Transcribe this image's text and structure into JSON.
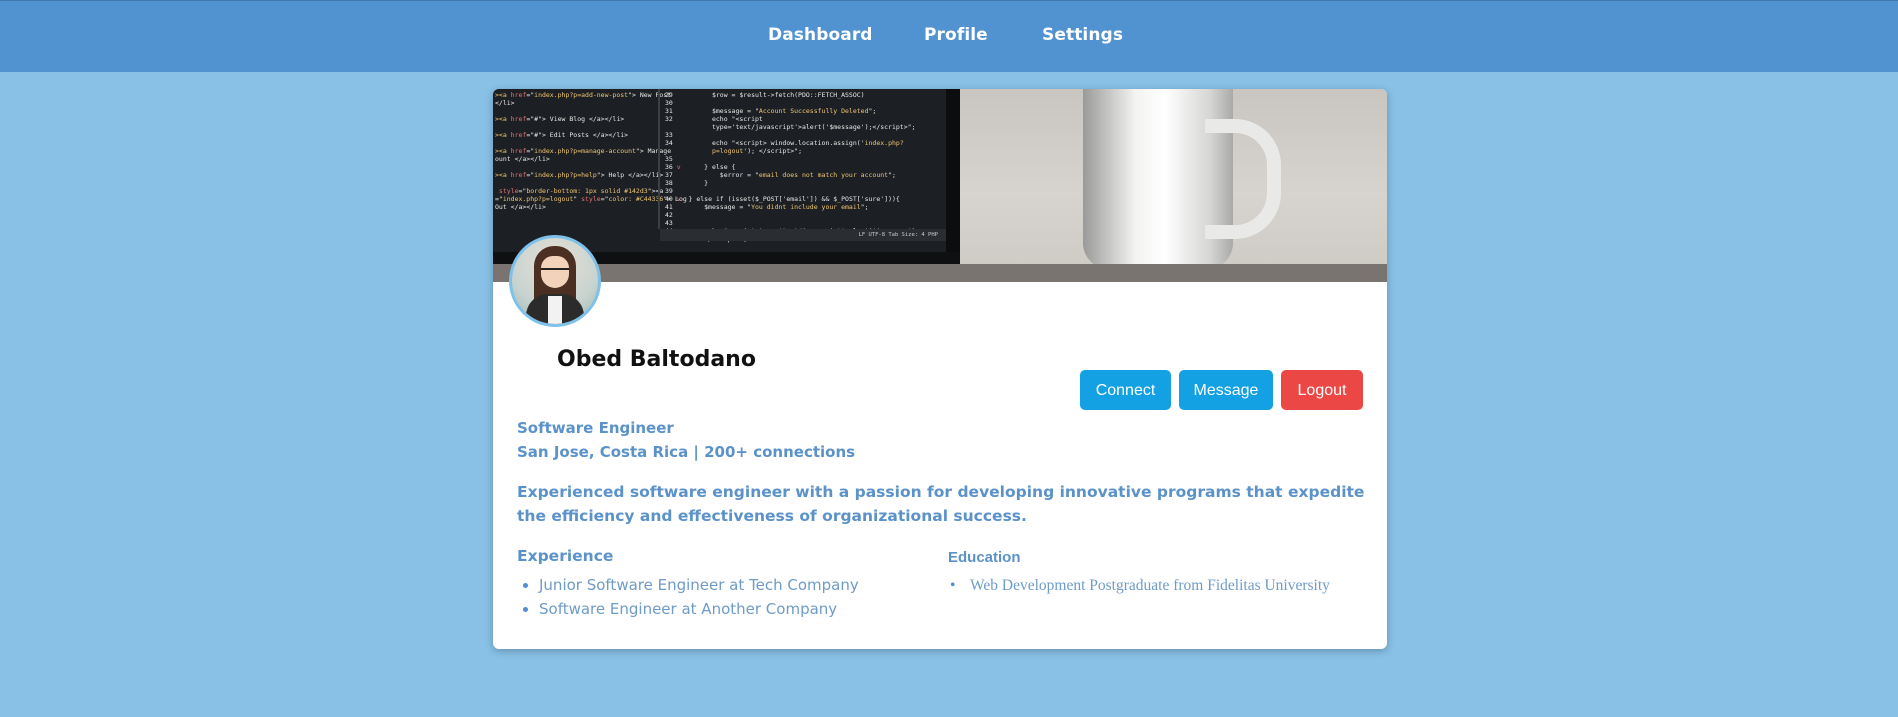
{
  "nav": {
    "items": [
      {
        "label": "Dashboard"
      },
      {
        "label": "Profile"
      },
      {
        "label": "Settings"
      }
    ]
  },
  "profile": {
    "name": "Obed Baltodano",
    "title": "Software Engineer",
    "location": "San Jose, Costa Rica | 200+ connections",
    "summary": "Experienced software engineer with a passion for developing innovative programs that expedite the efficiency and effectiveness of organizational success."
  },
  "actions": {
    "connect": "Connect",
    "message": "Message",
    "logout": "Logout"
  },
  "experience": {
    "heading": "Experience",
    "items": [
      "Junior Software Engineer at Tech Company",
      "Software Engineer at Another Company"
    ]
  },
  "education": {
    "heading": "Education",
    "items": [
      "Web Development Postgraduate from Fidelitas University"
    ]
  },
  "colors": {
    "nav_bg": "#5192d0",
    "page_bg": "#88c0e6",
    "accent_blue": "#14a1e3",
    "logout_red": "#ea4745",
    "text_blue": "#5b92c9"
  },
  "icons": {
    "avatar": "avatar-illustration"
  }
}
